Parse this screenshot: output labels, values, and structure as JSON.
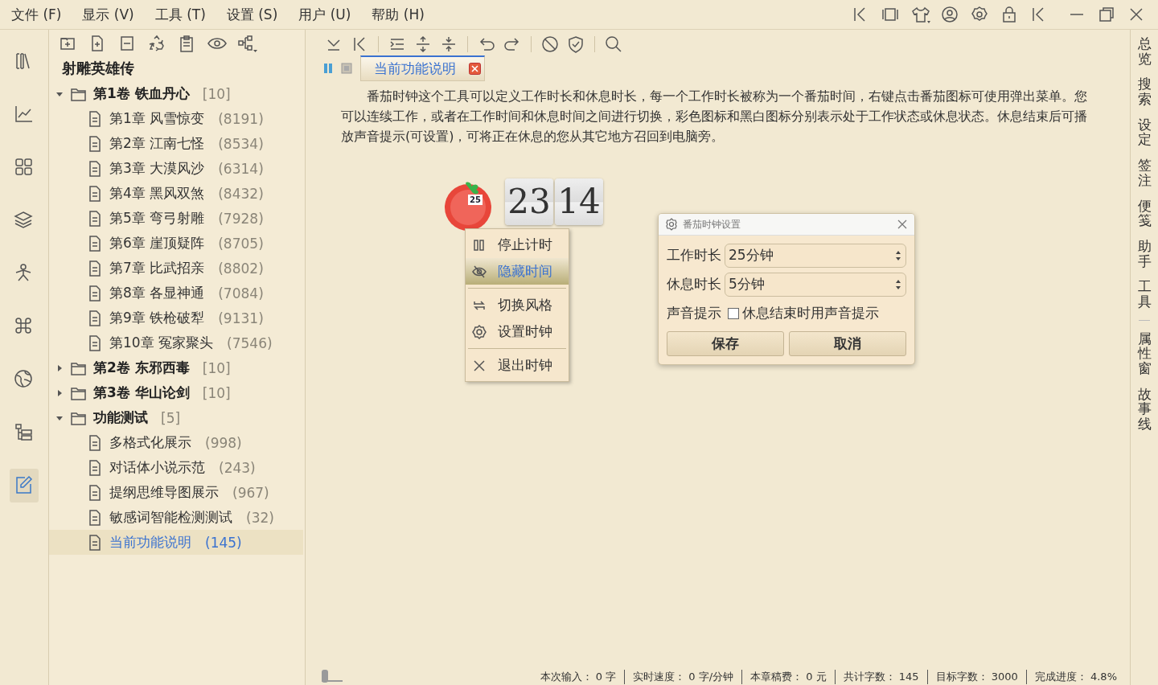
{
  "menu": [
    "文件 (F)",
    "显示 (V)",
    "工具 (T)",
    "设置 (S)",
    "用户 (U)",
    "帮助 (H)"
  ],
  "activity_bar": [
    {
      "selected": false
    },
    {
      "selected": false
    },
    {
      "selected": false
    },
    {
      "selected": false
    },
    {
      "selected": false
    },
    {
      "selected": false
    },
    {
      "selected": false
    },
    {
      "selected": false
    },
    {
      "selected": true
    }
  ],
  "tree": {
    "title": "射雕英雄传",
    "volumes": [
      {
        "title": "第1卷 铁血丹心",
        "count": "[10]",
        "expanded": true,
        "children": [
          {
            "title": "第1章 风雪惊变",
            "count": "(8191)",
            "selected": false
          },
          {
            "title": "第2章 江南七怪",
            "count": "(8534)",
            "selected": false
          },
          {
            "title": "第3章 大漠风沙",
            "count": "(6314)",
            "selected": false
          },
          {
            "title": "第4章 黑风双煞",
            "count": "(8432)",
            "selected": false
          },
          {
            "title": "第5章 弯弓射雕",
            "count": "(7928)",
            "selected": false
          },
          {
            "title": "第6章 崖顶疑阵",
            "count": "(8705)",
            "selected": false
          },
          {
            "title": "第7章 比武招亲",
            "count": "(8802)",
            "selected": false
          },
          {
            "title": "第8章 各显神通",
            "count": "(7084)",
            "selected": false
          },
          {
            "title": "第9章 铁枪破犁",
            "count": "(9131)",
            "selected": false
          },
          {
            "title": "第10章 冤家聚头",
            "count": "(7546)",
            "selected": false
          }
        ]
      },
      {
        "title": "第2卷 东邪西毒",
        "count": "[10]",
        "expanded": false
      },
      {
        "title": "第3卷 华山论剑",
        "count": "[10]",
        "expanded": false
      },
      {
        "title": "功能测试",
        "count": "[5]",
        "expanded": true,
        "children": [
          {
            "title": "多格式化展示",
            "count": "(998)",
            "selected": false
          },
          {
            "title": "对话体小说示范",
            "count": "(243)",
            "selected": false
          },
          {
            "title": "提纲思维导图展示",
            "count": "(967)",
            "selected": false
          },
          {
            "title": "敏感词智能检测测试",
            "count": "(32)",
            "selected": false
          },
          {
            "title": "当前功能说明",
            "count": "(145)",
            "selected": true
          }
        ]
      }
    ]
  },
  "tabs": [
    {
      "label": "当前功能说明",
      "selected": true
    }
  ],
  "paragraph": "番茄时钟这个工具可以定义工作时长和休息时长，每一个工作时长被称为一个番茄时间，右键点击番茄图标可使用弹出菜单。您可以连续工作，或者在工作时间和休息时间之间进行切换，彩色图标和黑白图标分别表示处于工作状态或休息状态。休息结束后可播放声音提示(可设置)，可将正在休息的您从其它地方召回到电脑旁。",
  "tomato": {
    "badge": "25",
    "hours": "23",
    "minutes": "14"
  },
  "context_menu": [
    {
      "kind": "item",
      "label": "停止计时",
      "selected": false
    },
    {
      "kind": "item",
      "label": "隐藏时间",
      "selected": true
    },
    {
      "kind": "separator"
    },
    {
      "kind": "item",
      "label": "切换风格",
      "selected": false
    },
    {
      "kind": "item",
      "label": "设置时钟",
      "selected": false
    },
    {
      "kind": "separator"
    },
    {
      "kind": "item",
      "label": "退出时钟",
      "selected": false
    }
  ],
  "dialog": {
    "title": "番茄时钟设置",
    "fields": [
      {
        "label": "工作时长",
        "value": "25分钟"
      },
      {
        "label": "休息时长",
        "value": "5分钟"
      }
    ],
    "sound": {
      "label": "声音提示",
      "option": "休息结束时用声音提示",
      "checked": false
    },
    "buttons": [
      "保存",
      "取消"
    ]
  },
  "status_bar": {
    "zoom": {
      "level": 0
    },
    "items": [
      {
        "label": "本次输入：",
        "value": "0",
        "unit": "字"
      },
      {
        "label": "实时速度：",
        "value": "0",
        "unit": "字/分钟"
      },
      {
        "label": "本章稿费：",
        "value": "0",
        "unit": "元"
      },
      {
        "label": "共计字数：",
        "value": "145"
      },
      {
        "label": "目标字数：",
        "value": "3000"
      },
      {
        "label": "完成进度：",
        "value": "4.8%"
      }
    ]
  },
  "right_panel": [
    [
      {
        "label": "总览"
      },
      {
        "label": "搜索"
      },
      {
        "label": "设定"
      },
      {
        "label": "签注"
      },
      {
        "label": "便笺"
      },
      {
        "label": "助手"
      },
      {
        "label": "工具"
      }
    ],
    [
      {
        "label": "属性窗"
      },
      {
        "label": "故事线"
      }
    ]
  ]
}
